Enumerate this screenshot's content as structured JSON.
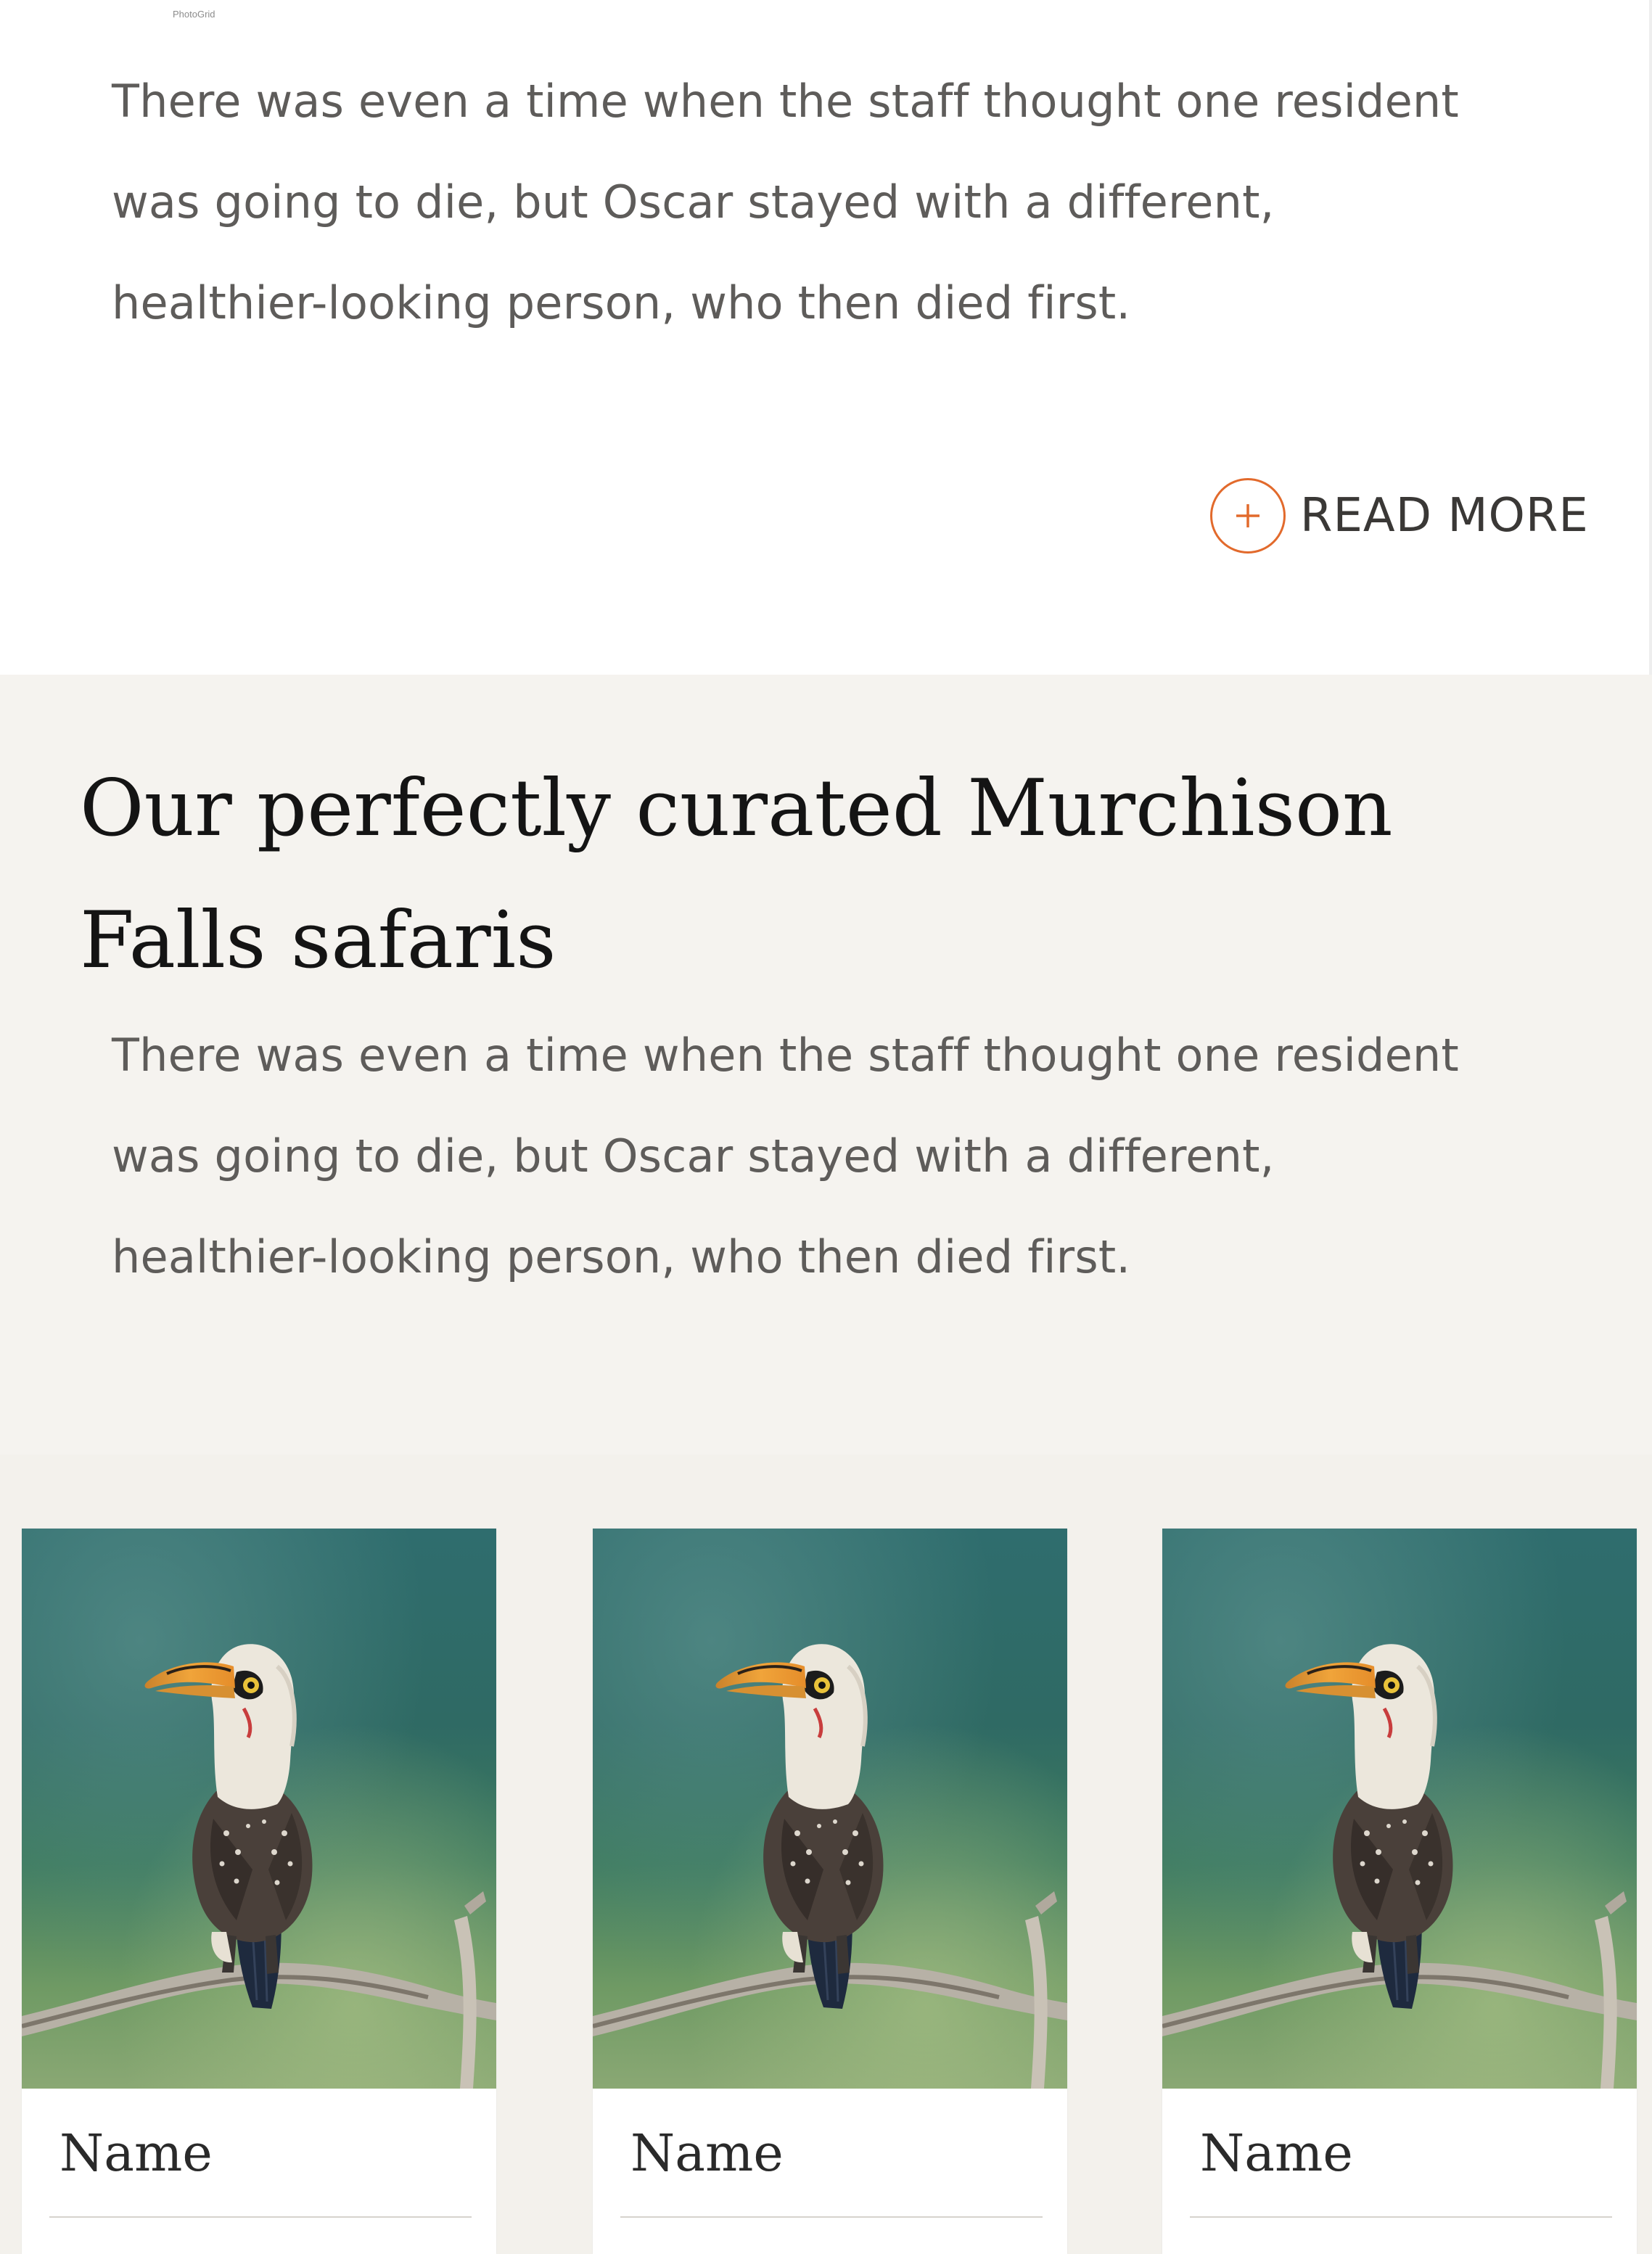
{
  "watermark": "PhotoGrid",
  "intro": {
    "lines": [
      "There was even a time when the staff thought one resident",
      "was going to die, but Oscar stayed with a different,",
      "healthier-looking person, who then died first."
    ],
    "read_more_label": "READ MORE",
    "read_more_icon": "plus-circle-icon"
  },
  "safari_section": {
    "title_lines": [
      "Our perfectly curated Murchison",
      "Falls safaris"
    ],
    "paragraph_lines": [
      "There was even a time when the staff thought one resident",
      "was going to die, but Oscar stayed with a different,",
      "healthier-looking person, who then died first."
    ]
  },
  "cards": [
    {
      "name": "Name",
      "image": "hornbill-on-branch"
    },
    {
      "name": "Name",
      "image": "hornbill-on-branch"
    },
    {
      "name": "Name",
      "image": "hornbill-on-branch"
    }
  ],
  "colors": {
    "accent": "#e26a2c",
    "section_bg": "#f5f3ef",
    "body_text": "#5e5c5a",
    "heading_text": "#141414"
  }
}
